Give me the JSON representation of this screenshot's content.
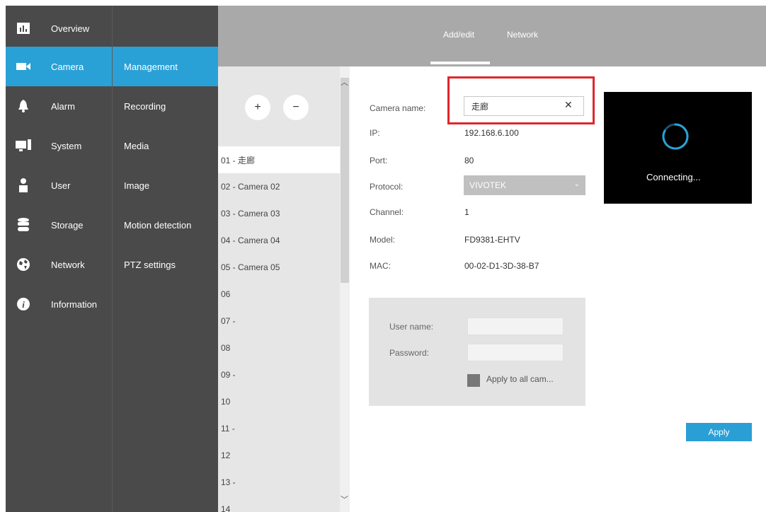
{
  "nav": {
    "items": [
      {
        "label": "Overview",
        "icon": "overview-chart-icon"
      },
      {
        "label": "Camera",
        "icon": "camera-icon"
      },
      {
        "label": "Alarm",
        "icon": "bell-icon"
      },
      {
        "label": "System",
        "icon": "monitor-icon"
      },
      {
        "label": "User",
        "icon": "user-icon"
      },
      {
        "label": "Storage",
        "icon": "database-icon"
      },
      {
        "label": "Network",
        "icon": "globe-icon"
      },
      {
        "label": "Information",
        "icon": "info-icon"
      }
    ],
    "active": "Camera"
  },
  "subnav": {
    "items": [
      "Management",
      "Recording",
      "Media",
      "Image",
      "Motion detection",
      "PTZ settings"
    ],
    "active": "Management"
  },
  "tabs": {
    "add_edit": "Add/edit",
    "network": "Network"
  },
  "camera_list": {
    "add_label": "+",
    "remove_label": "−",
    "rows": [
      "01 - 走廊",
      "02 - Camera 02",
      "03 - Camera 03",
      "04 - Camera 04",
      "05 - Camera 05",
      "06",
      "07 -",
      "08",
      "09 -",
      "10",
      "11 -",
      "12",
      "13 -",
      "14"
    ]
  },
  "form": {
    "camera_name_label": "Camera name:",
    "camera_name_value": "走廊",
    "ip_label": "IP:",
    "ip_value": "192.168.6.100",
    "port_label": "Port:",
    "port_value": "80",
    "protocol_label": "Protocol:",
    "protocol_value": "VIVOTEK",
    "channel_label": "Channel:",
    "channel_value": "1",
    "model_label": "Model:",
    "model_value": "FD9381-EHTV",
    "mac_label": "MAC:",
    "mac_value": "00-02-D1-3D-38-B7"
  },
  "credentials": {
    "username_label": "User name:",
    "password_label": "Password:",
    "apply_all_label": "Apply to all cam..."
  },
  "preview": {
    "status": "Connecting..."
  },
  "apply_label": "Apply",
  "colors": {
    "accent": "#2aa1d6",
    "nav_bg": "#4a4a4a",
    "highlight": "#e0262b"
  }
}
